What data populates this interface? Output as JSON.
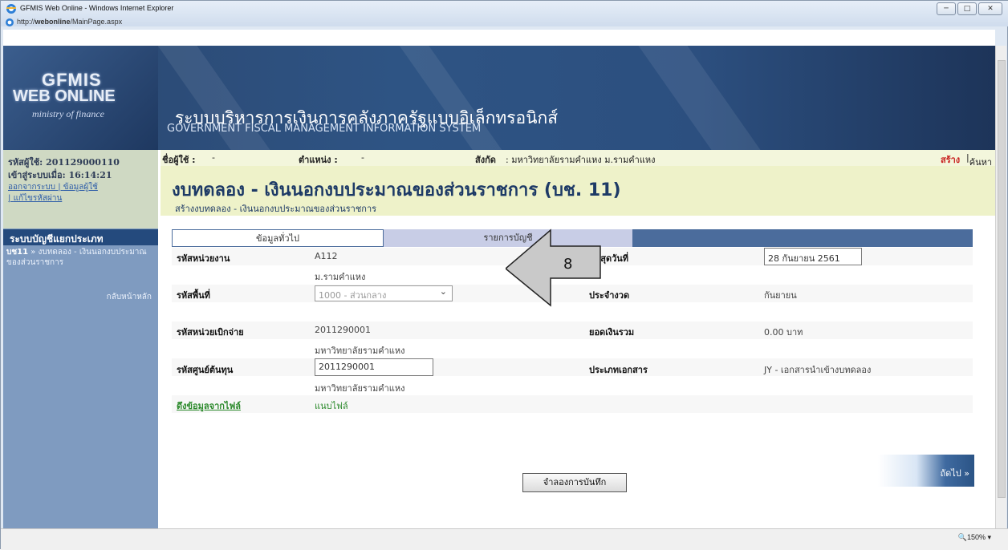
{
  "window": {
    "title": "GFMIS Web Online - Windows Internet Explorer",
    "url_prefix": "http://",
    "url_host": "webonline",
    "url_path": "/MainPage.aspx",
    "zoom": "150%"
  },
  "banner": {
    "logo_line1": "GFMIS",
    "logo_line2": "WEB ONLINE",
    "logo_line3": "ministry of finance",
    "title_th": "ระบบบริหารการเงินการคลังภาครัฐแบบอิเล็กทรอนิกส์",
    "title_en": "GOVERNMENT FISCAL MANAGEMENT INFORMATION SYSTEM"
  },
  "sidebar": {
    "user_label": "รหัสผู้ใช้:",
    "user_id": "201129000110",
    "login_label": "เข้าสู่ระบบเมื่อ:",
    "login_time": "16:14:21",
    "link_logout": "ออกจากระบบ",
    "link_profile": "ข้อมูลผู้ใช้",
    "link_password": "แก้ไขรหัสผ่าน",
    "section_head": "ระบบบัญชีแยกประเภท",
    "menu_code": "บช11",
    "menu_text": "» งบทดลอง - เงินนอกงบประมาณของส่วนราชการ",
    "back_home": "กลับหน้าหลัก"
  },
  "infostrip": {
    "user_name_label": "ชื่อผู้ใช้ :",
    "user_name_value": "-",
    "position_label": "ตำแหน่ง :",
    "position_value": "-",
    "affiliation_label": "สังกัด",
    "affiliation_value": ": มหาวิทยาลัยรามคำแหง ม.รามคำแหง",
    "create": "สร้าง",
    "search": "ค้นหา"
  },
  "header": {
    "title": "งบทดลอง - เงินนอกงบประมาณของส่วนราชการ (บช. 11)",
    "subtitle": "สร้างงบทดลอง - เงินนอกงบประมาณของส่วนราชการ"
  },
  "tabs": [
    "ข้อมูลทั่วไป",
    "รายการบัญชี"
  ],
  "callout_number": "8",
  "form": {
    "unit_code_label": "รหัสหน่วยงาน",
    "unit_code": "A112",
    "unit_name": "ม.รามคำแหง",
    "end_date_label": "สิ้นสุดวันที่",
    "end_date": "28 กันยายน 2561",
    "area_code_label": "รหัสพื้นที่",
    "area_code": "1000 - ส่วนกลาง",
    "period_label": "ประจำงวด",
    "period": "กันยายน",
    "disb_unit_label": "รหัสหน่วยเบิกจ่าย",
    "disb_unit": "2011290001",
    "disb_unit_name": "มหาวิทยาลัยรามคำแหง",
    "total_label": "ยอดเงินรวม",
    "total": "0.00 บาท",
    "cost_center_label": "รหัสศูนย์ต้นทุน",
    "cost_center": "2011290001",
    "cost_center_name": "มหาวิทยาลัยรามคำแหง",
    "doc_type_label": "ประเภทเอกสาร",
    "doc_type": "JY - เอกสารนำเข้างบทดลอง",
    "fetch_file": "ดึงข้อมูลจากไฟล์",
    "attach_file": "แนบไฟล์"
  },
  "buttons": {
    "next": "ถัดไป »",
    "simulate": "จำลองการบันทึก"
  }
}
